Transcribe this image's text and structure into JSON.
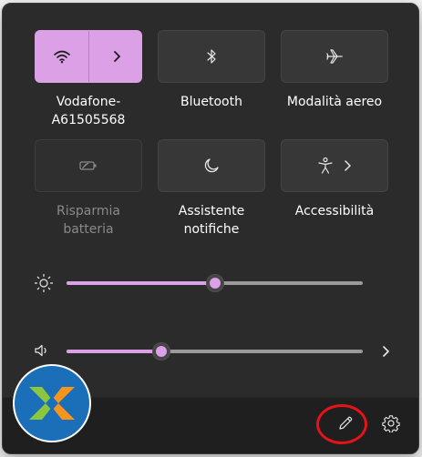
{
  "quick_settings": {
    "tiles": [
      {
        "label": "Vodafone-\nA61505568",
        "label_line1": "Vodafone-",
        "label_line2": "A61505568",
        "icon": "wifi-icon",
        "state": "on",
        "has_expand": true
      },
      {
        "label": "Bluetooth",
        "icon": "bluetooth-icon",
        "state": "off"
      },
      {
        "label": "Modalità aereo",
        "icon": "airplane-icon",
        "state": "off"
      },
      {
        "label_line1": "Risparmia",
        "label_line2": "batteria",
        "icon": "battery-saver-icon",
        "state": "disabled"
      },
      {
        "label_line1": "Assistente",
        "label_line2": "notifiche",
        "icon": "moon-icon",
        "state": "off"
      },
      {
        "label": "Accessibilità",
        "icon": "accessibility-icon",
        "state": "off",
        "has_expand": true
      }
    ]
  },
  "brightness": {
    "icon": "sun-icon",
    "value": 0.5
  },
  "volume": {
    "icon": "speaker-icon",
    "value": 0.32,
    "expand_icon": "chevron-right-icon"
  },
  "footer": {
    "edit_icon": "pencil-icon",
    "settings_icon": "gear-icon",
    "logo": "app-logo"
  },
  "colors": {
    "accent": "#dba0e6",
    "panel": "#2b2b2b",
    "footer": "#1f1f1f",
    "highlight_circle": "#e3131a"
  }
}
